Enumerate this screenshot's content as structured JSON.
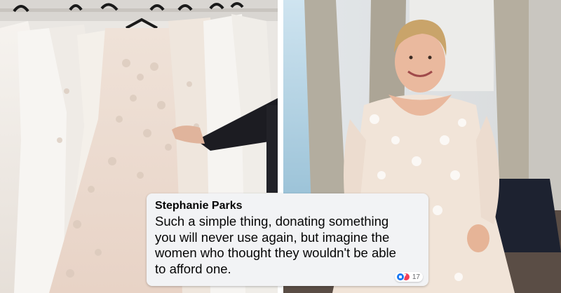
{
  "comment": {
    "author": "Stephanie Parks",
    "lines": [
      "Such a simple thing, donating something",
      "you will never use again, but imagine the",
      "women who thought they wouldn't be able",
      "to afford one."
    ],
    "reaction_count": "17",
    "reaction_icons": [
      "like-icon",
      "love-icon"
    ]
  },
  "photos": {
    "left": "wedding-dresses-rack-photo",
    "right": "woman-in-wedding-dress-photo"
  },
  "colors": {
    "comment_bg": "#f2f3f5",
    "text": "#050505",
    "like": "#1877f2",
    "love": "#f33e58"
  }
}
